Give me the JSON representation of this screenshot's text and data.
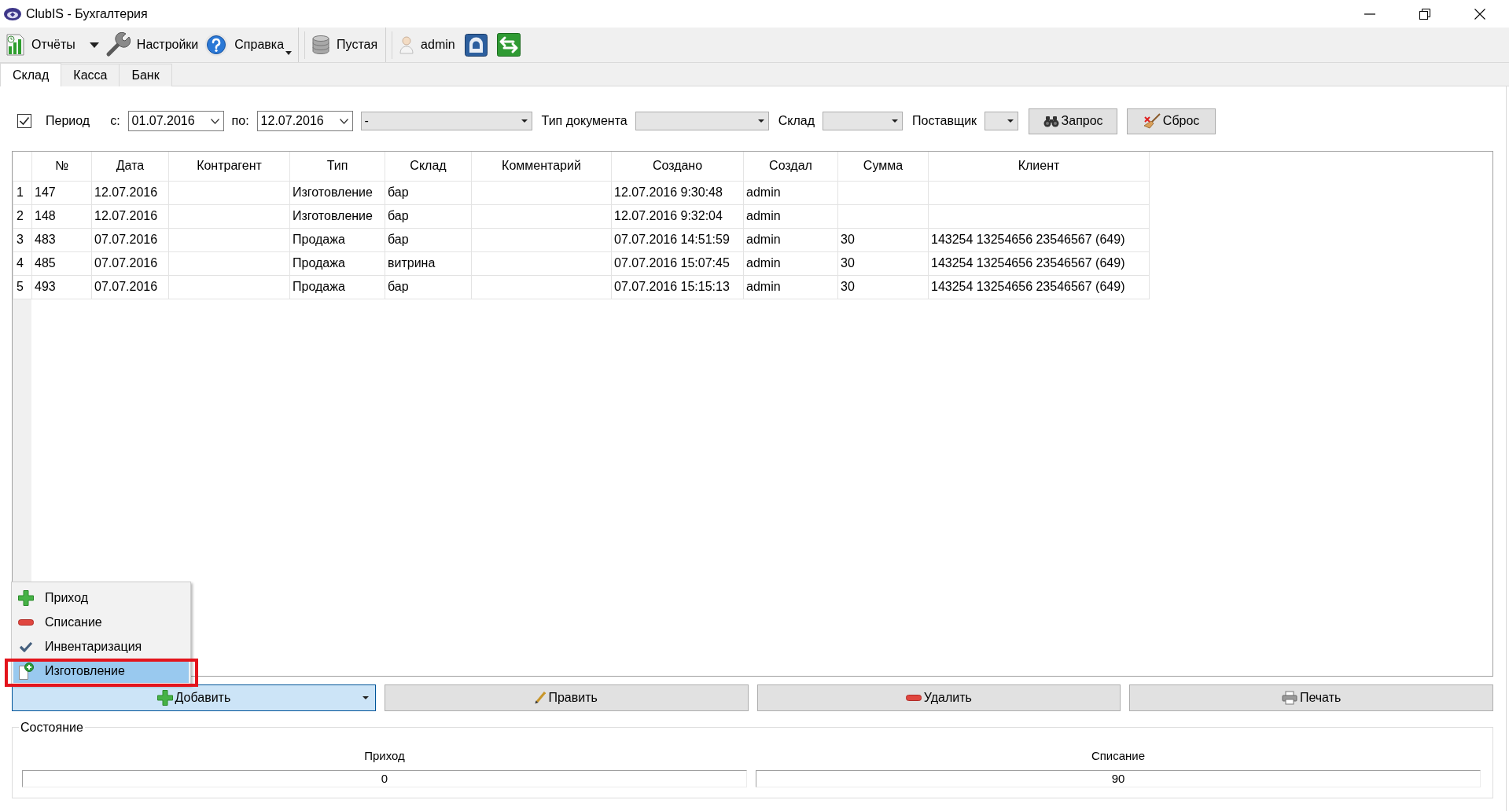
{
  "window": {
    "title": "ClubIS - Бухгалтерия"
  },
  "toolbar": {
    "groups": [
      [
        {
          "kind": "dropdown",
          "label": "Отчёты"
        },
        {
          "kind": "button",
          "label": "Настройки"
        },
        {
          "kind": "menu",
          "label": "Справка"
        }
      ],
      [
        {
          "kind": "label",
          "label": "Пустая"
        }
      ],
      [
        {
          "kind": "label",
          "label": "admin"
        },
        {
          "kind": "icon"
        },
        {
          "kind": "icon"
        }
      ]
    ]
  },
  "tabs": [
    {
      "label": "Склад",
      "selected": true
    },
    {
      "label": "Касса",
      "selected": false
    },
    {
      "label": "Банк",
      "selected": false
    }
  ],
  "filter_bar": {
    "period": {
      "label": "Период",
      "checked": true
    },
    "date_from": {
      "label": "с:",
      "value": "01.07.2016"
    },
    "date_to": {
      "label": "по:",
      "value": "12.07.2016"
    },
    "selector": {
      "value": "-"
    },
    "combos": [
      {
        "label": "Тип документа"
      },
      {
        "label": "Склад"
      },
      {
        "label": "Поставщик"
      }
    ],
    "buttons": [
      {
        "label": "Запрос"
      },
      {
        "label": "Сброс"
      }
    ]
  },
  "table": {
    "columns": [
      "№",
      "Дата",
      "Контрагент",
      "Тип",
      "Склад",
      "Комментарий",
      "Создано",
      "Создал",
      "Сумма",
      "Клиент"
    ],
    "rows": [
      {
        "row_label": "1",
        "number": "147",
        "date": "12.07.2016",
        "type": "Изготовление",
        "warehouse": "бар",
        "created": "12.07.2016 9:30:48",
        "author": "admin"
      },
      {
        "row_label": "2",
        "number": "148",
        "date": "12.07.2016",
        "type": "Изготовление",
        "warehouse": "бар",
        "created": "12.07.2016 9:32:04",
        "author": "admin"
      },
      {
        "row_label": "3",
        "number": "483",
        "date": "07.07.2016",
        "type": "Продажа",
        "warehouse": "бар",
        "created": "07.07.2016 14:51:59",
        "author": "admin",
        "sum": "30",
        "client": "143254 13254656 23546567 (649)"
      },
      {
        "row_label": "4",
        "number": "485",
        "date": "07.07.2016",
        "type": "Продажа",
        "warehouse": "витрина",
        "created": "07.07.2016 15:07:45",
        "author": "admin",
        "sum": "30",
        "client": "143254 13254656 23546567 (649)"
      },
      {
        "row_label": "5",
        "number": "493",
        "date": "07.07.2016",
        "type": "Продажа",
        "warehouse": "бар",
        "created": "07.07.2016 15:15:13",
        "author": "admin",
        "sum": "30",
        "client": "143254 13254656 23546567 (649)"
      }
    ]
  },
  "add_menu": {
    "items": [
      {
        "label": "Приход",
        "selected": false,
        "outlined": false
      },
      {
        "label": "Списание",
        "selected": false,
        "outlined": false
      },
      {
        "label": "Инвентаризация",
        "selected": false,
        "outlined": false
      },
      {
        "label": "Изготовление",
        "selected": true,
        "outlined": true
      }
    ]
  },
  "actions": [
    {
      "kind": "dropdown",
      "label": "Добавить",
      "expanded": true
    },
    {
      "kind": "button",
      "label": "Править"
    },
    {
      "kind": "button",
      "label": "Удалить"
    },
    {
      "kind": "button",
      "label": "Печать"
    }
  ],
  "status": {
    "title": "Состояние",
    "fields": [
      {
        "label": "Приход",
        "value": "0"
      },
      {
        "label": "Списание",
        "value": "90"
      }
    ]
  }
}
